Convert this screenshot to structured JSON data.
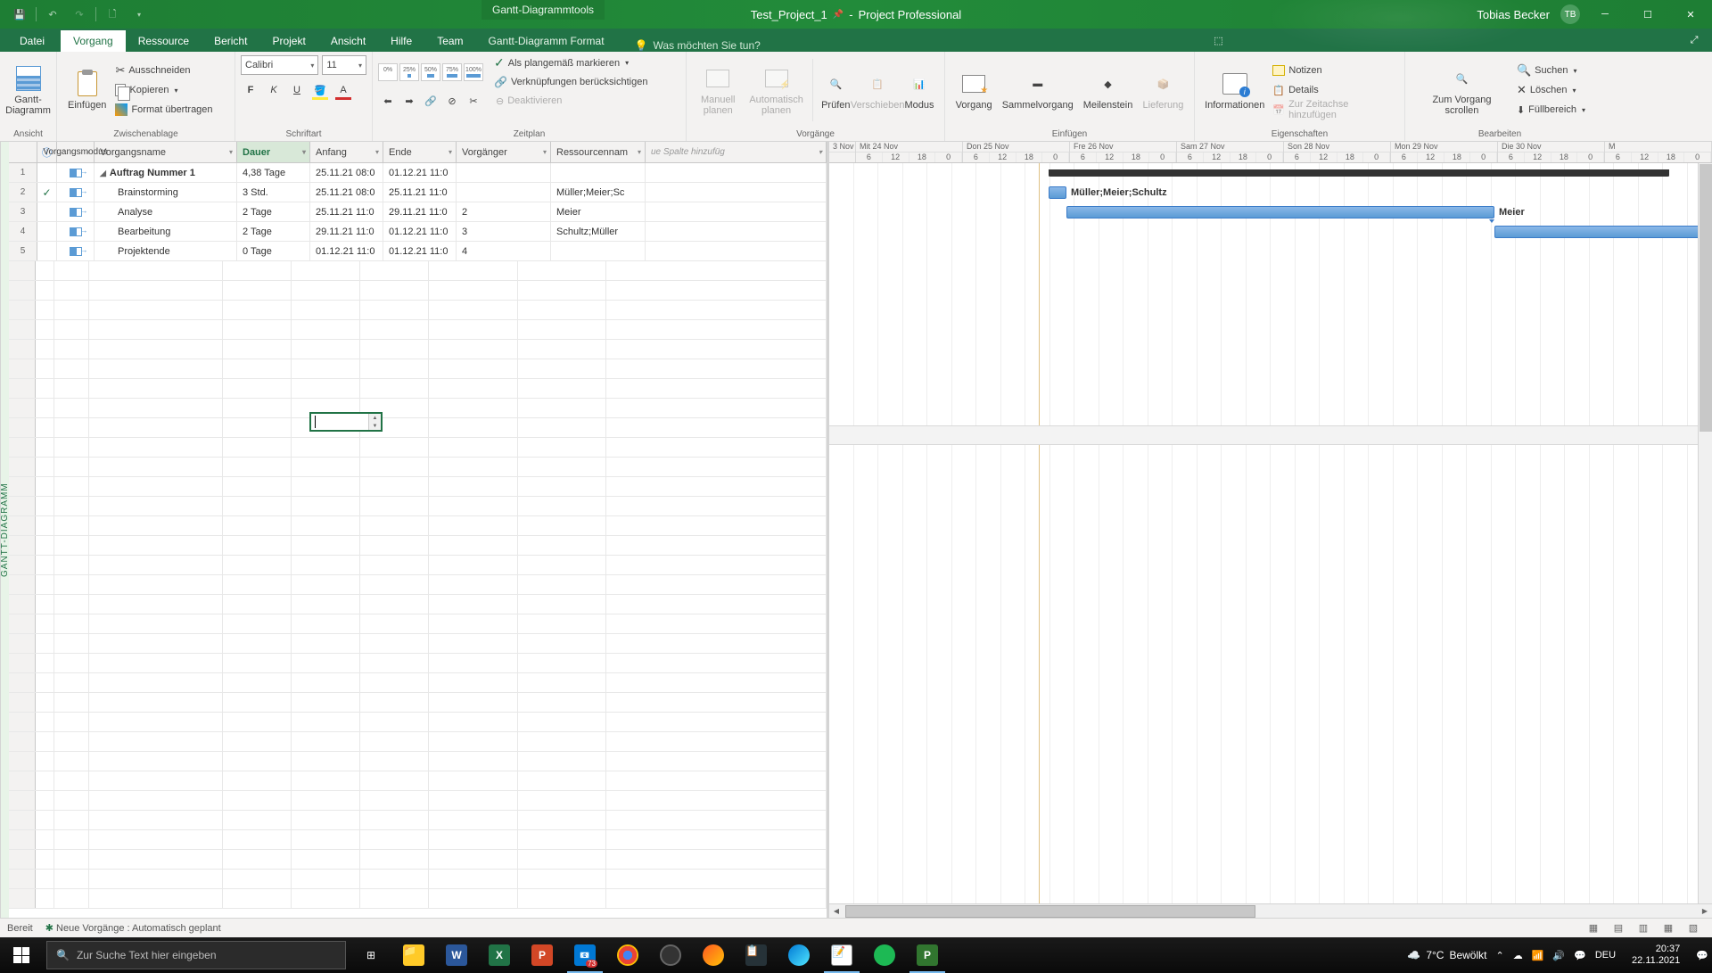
{
  "titlebar": {
    "tools_tab": "Gantt-Diagrammtools",
    "doc": "Test_Project_1",
    "app": "Project Professional",
    "user": "Tobias Becker",
    "initials": "TB"
  },
  "tabs": {
    "file": "Datei",
    "items": [
      "Vorgang",
      "Ressource",
      "Bericht",
      "Projekt",
      "Ansicht",
      "Hilfe",
      "Team"
    ],
    "active": "Vorgang",
    "format": "Gantt-Diagramm Format",
    "search_placeholder": "Was möchten Sie tun?"
  },
  "ribbon": {
    "view": {
      "gantt": "Gantt-\nDiagramm",
      "group": "Ansicht"
    },
    "clipboard": {
      "paste": "Einfügen",
      "cut": "Ausschneiden",
      "copy": "Kopieren",
      "fmt": "Format übertragen",
      "group": "Zwischenablage"
    },
    "font": {
      "name": "Calibri",
      "size": "11",
      "group": "Schriftart"
    },
    "schedule": {
      "pcts": [
        "0%",
        "25%",
        "50%",
        "75%",
        "100%"
      ],
      "mark": "Als plangemäß markieren",
      "links": "Verknüpfungen berücksichtigen",
      "deact": "Deaktivieren",
      "group": "Zeitplan"
    },
    "tasks": {
      "manual": "Manuell\nplanen",
      "auto": "Automatisch\nplanen",
      "check": "Prüfen",
      "move": "Verschieben",
      "mode": "Modus",
      "group": "Vorgänge"
    },
    "insert": {
      "task": "Vorgang",
      "summary": "Sammelvorgang",
      "milestone": "Meilenstein",
      "deliv": "Lieferung",
      "group": "Einfügen"
    },
    "props": {
      "info": "Informationen",
      "notes": "Notizen",
      "details": "Details",
      "timeline": "Zur Zeitachse hinzufügen",
      "group": "Eigenschaften"
    },
    "edit": {
      "scroll": "Zum Vorgang\nscrollen",
      "find": "Suchen",
      "del": "Löschen",
      "fill": "Füllbereich",
      "group": "Bearbeiten"
    }
  },
  "columns": [
    "",
    "Vorgangsmodus",
    "Vorgangsname",
    "Dauer",
    "Anfang",
    "Ende",
    "Vorgänger",
    "Ressourcennam",
    "ue Spalte hinzufüg"
  ],
  "col_info_icon": "ⓘ",
  "active_col": "Dauer",
  "rows": [
    {
      "n": "1",
      "ind": "",
      "name": "Auftrag Nummer 1",
      "summary": true,
      "dur": "4,38 Tage",
      "start": "25.11.21 08:0",
      "end": "01.12.21 11:0",
      "pred": "",
      "res": ""
    },
    {
      "n": "2",
      "ind": "✓",
      "name": "Brainstorming",
      "dur": "3 Std.",
      "start": "25.11.21 08:0",
      "end": "25.11.21 11:0",
      "pred": "",
      "res": "Müller;Meier;Sc"
    },
    {
      "n": "3",
      "ind": "",
      "name": "Analyse",
      "dur": "2 Tage",
      "start": "25.11.21 11:0",
      "end": "29.11.21 11:0",
      "pred": "2",
      "res": "Meier"
    },
    {
      "n": "4",
      "ind": "",
      "name": "Bearbeitung",
      "dur": "2 Tage",
      "start": "29.11.21 11:0",
      "end": "01.12.21 11:0",
      "pred": "3",
      "res": "Schultz;Müller"
    },
    {
      "n": "5",
      "ind": "",
      "name": "Projektende",
      "dur": "0 Tage",
      "start": "01.12.21 11:0",
      "end": "01.12.21 11:0",
      "pred": "4",
      "res": ""
    }
  ],
  "gantt": {
    "days": [
      "3 Nov",
      "Mit 24 Nov",
      "Don 25 Nov",
      "Fre 26 Nov",
      "Sam 27 Nov",
      "Son 28 Nov",
      "Mon 29 Nov",
      "Die 30 Nov",
      "M"
    ],
    "hours": [
      "6",
      "12",
      "18",
      "0"
    ],
    "labels": {
      "r2": "Müller;Meier;Schultz",
      "r3": "Meier"
    }
  },
  "status": {
    "ready": "Bereit",
    "mode_icon": "✱",
    "mode": "Neue Vorgänge : Automatisch geplant"
  },
  "taskbar": {
    "search": "Zur Suche Text hier eingeben",
    "badge": "73",
    "weather_t": "7°C",
    "weather_c": "Bewölkt",
    "lang": "DEU",
    "time": "20:37",
    "date": "22.11.2021"
  },
  "sidebar_label": "GANTT-DIAGRAMM"
}
